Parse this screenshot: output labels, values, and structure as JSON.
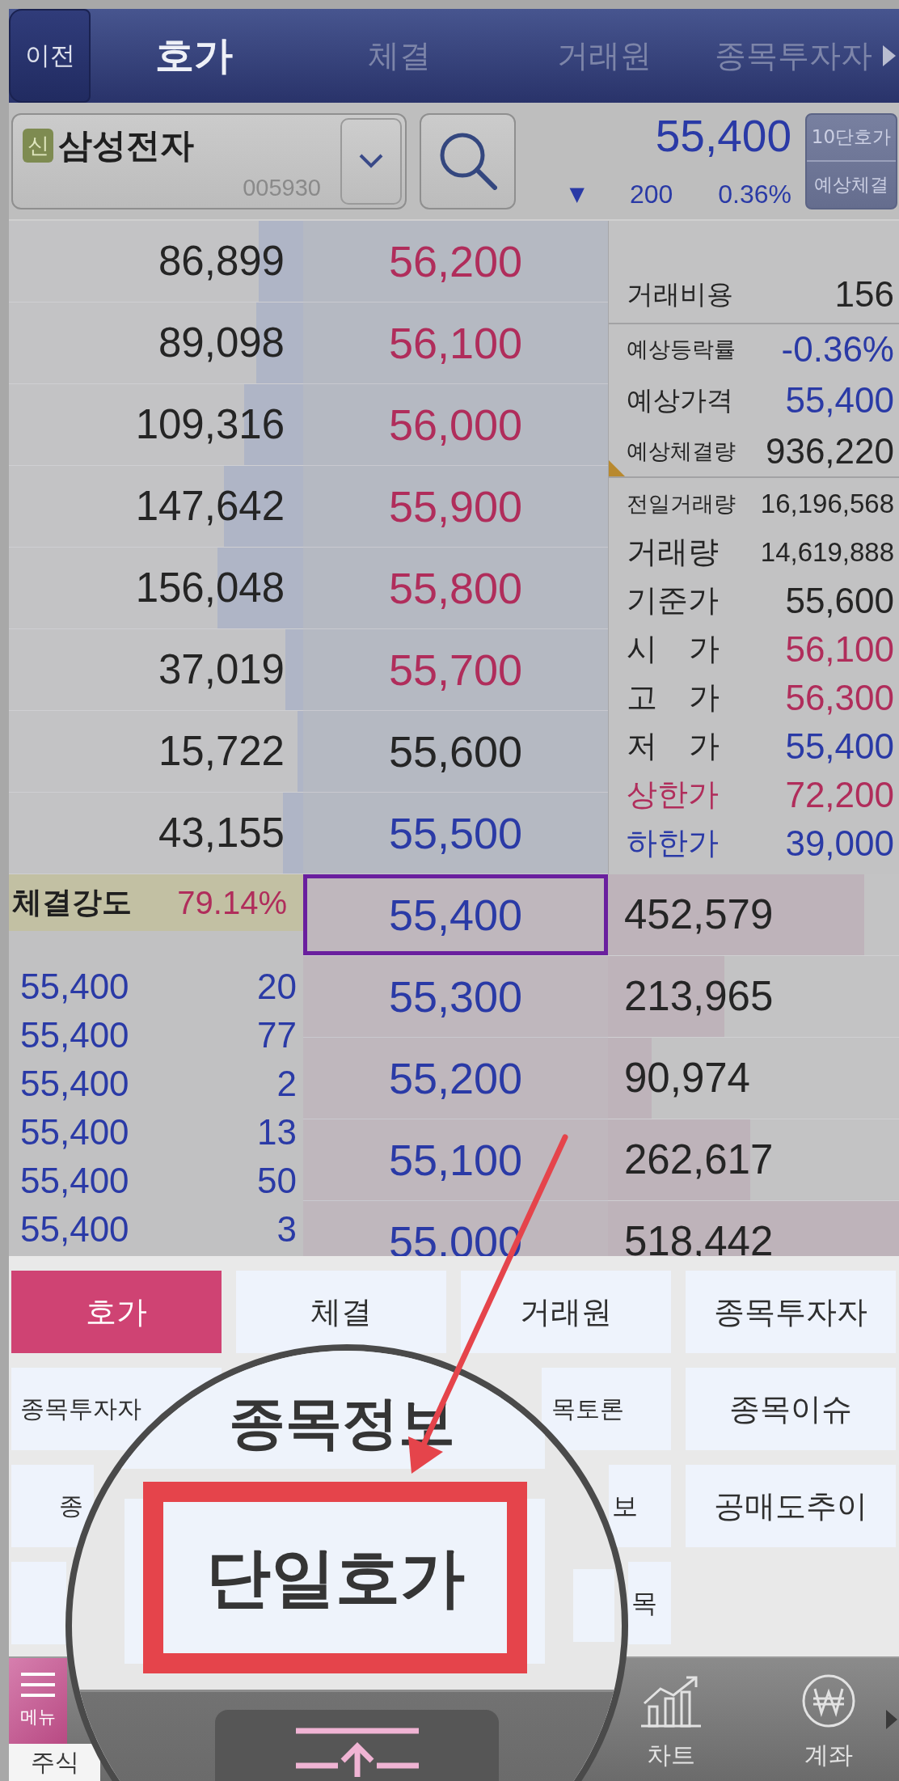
{
  "header": {
    "back": "이전",
    "tabs": [
      {
        "label": "호가",
        "selected": true
      },
      {
        "label": "체결",
        "selected": false
      },
      {
        "label": "거래원",
        "selected": false
      },
      {
        "label": "종목투자자",
        "selected": false
      }
    ]
  },
  "stock": {
    "badge": "신",
    "name": "삼성전자",
    "code": "005930",
    "price": "55,400",
    "change_sign": "▼",
    "change": "200",
    "rate": "0.36%",
    "mode_button": [
      "10단호가",
      "예상체결"
    ]
  },
  "asks": [
    {
      "quantity": "86,899",
      "level": 0.15,
      "price": "56,200",
      "color": "#b02d5b",
      "selected": false
    },
    {
      "quantity": "89,098",
      "level": 0.16,
      "price": "56,100",
      "color": "#b02d5b",
      "selected": false
    },
    {
      "quantity": "109,316",
      "level": 0.2,
      "price": "56,000",
      "color": "#b02d5b",
      "selected": false
    },
    {
      "quantity": "147,642",
      "level": 0.27,
      "price": "55,900",
      "color": "#b02d5b",
      "selected": false
    },
    {
      "quantity": "156,048",
      "level": 0.29,
      "price": "55,800",
      "color": "#b02d5b",
      "selected": false
    },
    {
      "quantity": "37,019",
      "level": 0.06,
      "price": "55,700",
      "color": "#b02d5b",
      "selected": false
    },
    {
      "quantity": "15,722",
      "level": 0.02,
      "price": "55,600",
      "color": "#252525",
      "selected": false
    },
    {
      "quantity": "43,155",
      "level": 0.07,
      "price": "55,500",
      "color": "#2a3aa6",
      "selected": false
    }
  ],
  "info_sections": [
    {
      "rows": [
        {
          "label": {
            "text": "거래비용",
            "color": "#252525"
          },
          "value": {
            "text": "156",
            "color": "#252525"
          }
        }
      ]
    },
    {
      "rows": [
        {
          "label": {
            "text": "예상등락률",
            "color": "#252525"
          },
          "value": {
            "text": "-0.36%",
            "color": "#2a3aa6"
          }
        },
        {
          "label": {
            "text": "예상가격",
            "color": "#252525"
          },
          "value": {
            "text": "55,400",
            "color": "#2a3aa6"
          }
        },
        {
          "label": {
            "text": "예상체결량",
            "color": "#252525"
          },
          "value": {
            "text": "936,220",
            "color": "#252525"
          }
        }
      ]
    },
    {
      "rows": [
        {
          "label": {
            "text": "전일거래량",
            "color": "#252525"
          },
          "value": {
            "text": "16,196,568",
            "color": "#252525"
          }
        },
        {
          "label": {
            "text": "거래량",
            "color": "#252525"
          },
          "value": {
            "text": "14,619,888",
            "color": "#252525"
          }
        },
        {
          "label": {
            "text": "기준가",
            "color": "#252525"
          },
          "value": {
            "text": "55,600",
            "color": "#252525"
          }
        },
        {
          "label": {
            "text": "시 가",
            "color": "#252525"
          },
          "value": {
            "text": "56,100",
            "color": "#b02d5b"
          }
        },
        {
          "label": {
            "text": "고 가",
            "color": "#252525"
          },
          "value": {
            "text": "56,300",
            "color": "#b02d5b"
          }
        },
        {
          "label": {
            "text": "저 가",
            "color": "#252525"
          },
          "value": {
            "text": "55,400",
            "color": "#2a3aa6"
          }
        },
        {
          "label": {
            "text": "상한가",
            "color": "#b02d5b"
          },
          "value": {
            "text": "72,200",
            "color": "#b02d5b"
          }
        },
        {
          "label": {
            "text": "하한가",
            "color": "#2a3aa6"
          },
          "value": {
            "text": "39,000",
            "color": "#2a3aa6"
          }
        }
      ]
    }
  ],
  "bids": {
    "strength": {
      "label": "체결강도",
      "value": "79.14%"
    },
    "ticks": [
      {
        "price": "55,400",
        "volume": "20",
        "color": "#2a3aa6"
      },
      {
        "price": "55,400",
        "volume": "77",
        "color": "#2a3aa6"
      },
      {
        "price": "55,400",
        "volume": "2",
        "color": "#2a3aa6"
      },
      {
        "price": "55,400",
        "volume": "13",
        "color": "#2a3aa6"
      },
      {
        "price": "55,400",
        "volume": "50",
        "color": "#2a3aa6"
      },
      {
        "price": "55,400",
        "volume": "3",
        "color": "#2a3aa6"
      }
    ],
    "levels": [
      {
        "price": "55,400",
        "color": "#2a3aa6",
        "quantity": "452,579",
        "level": 0.88,
        "selected": true
      },
      {
        "price": "55,300",
        "color": "#2a3aa6",
        "quantity": "213,965",
        "level": 0.4,
        "selected": false
      },
      {
        "price": "55,200",
        "color": "#2a3aa6",
        "quantity": "90,974",
        "level": 0.15,
        "selected": false
      },
      {
        "price": "55,100",
        "color": "#2a3aa6",
        "quantity": "262,617",
        "level": 0.49,
        "selected": false
      },
      {
        "price": "55,000",
        "color": "#2a3aa6",
        "quantity": "518,442",
        "level": 1,
        "selected": false
      }
    ]
  },
  "menu": {
    "rows": [
      [
        {
          "label": "호가",
          "selected": true
        },
        {
          "label": "체결",
          "selected": false
        },
        {
          "label": "거래원",
          "selected": false
        },
        {
          "label": "종목투자자",
          "selected": false
        }
      ],
      [
        {
          "label": "종목투자자",
          "selected": false
        },
        null,
        {
          "label": "목토론",
          "selected": false
        },
        {
          "label": "종목이슈",
          "selected": false
        }
      ],
      [
        {
          "label": "종",
          "selected": false
        },
        null,
        {
          "label": "보",
          "selected": false
        },
        {
          "label": "공매도추이",
          "selected": false
        }
      ],
      [
        {
          "selected": false
        },
        null,
        {
          "label": "목",
          "selected": false
        },
        null
      ]
    ]
  },
  "magnifier": {
    "tiles": [
      {
        "label": "종목정보",
        "highlighted": false
      },
      {
        "label": "단일호가",
        "highlighted": true
      }
    ]
  },
  "tab_bar": {
    "menu": "메뉴",
    "section": "주식",
    "tabs": [
      {
        "label": "차트",
        "kind": "chart"
      },
      {
        "label": "계좌",
        "kind": "account"
      }
    ]
  }
}
